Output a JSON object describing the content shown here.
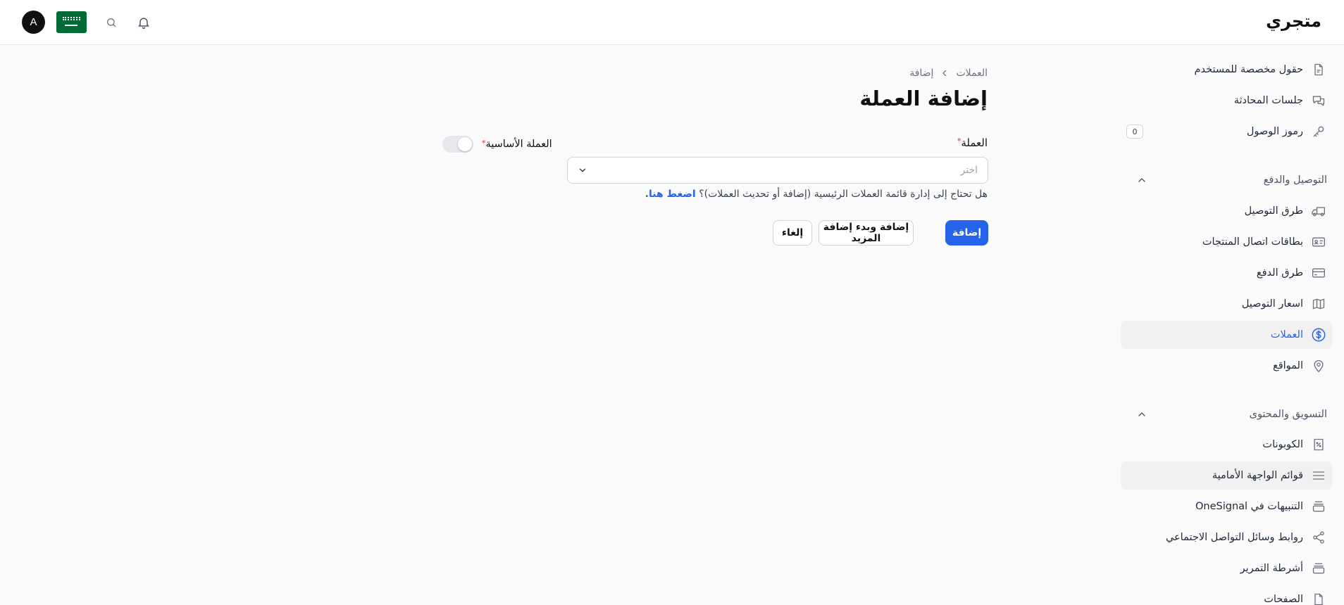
{
  "header": {
    "brand": "متجري",
    "avatar_letter": "A",
    "icons": {
      "notifications": "bell-icon",
      "search": "search-icon",
      "language": "saudi-flag-icon"
    }
  },
  "sidebar": {
    "items_top": [
      {
        "label": "حقول مخصصة للمستخدم",
        "icon": "document-icon"
      },
      {
        "label": "جلسات المحادثة",
        "icon": "chat-bubbles-icon"
      },
      {
        "label": "رموز الوصول",
        "icon": "key-icon",
        "badge": "0"
      }
    ],
    "section_shipping": {
      "title": "التوصيل والدفع",
      "items": [
        {
          "label": "طرق التوصيل",
          "icon": "truck-icon"
        },
        {
          "label": "بطاقات اتصال المنتجات",
          "icon": "id-card-icon"
        },
        {
          "label": "طرق الدفع",
          "icon": "credit-card-icon"
        },
        {
          "label": "اسعار التوصيل",
          "icon": "map-icon"
        },
        {
          "label": "العملات",
          "icon": "dollar-circle-icon",
          "active": true
        },
        {
          "label": "المواقع",
          "icon": "map-pin-icon"
        }
      ]
    },
    "section_marketing": {
      "title": "التسويق والمحتوى",
      "items": [
        {
          "label": "الكوبونات",
          "icon": "coupon-icon"
        },
        {
          "label": "قوائم الواجهة الأمامية",
          "icon": "menu-lines-icon"
        },
        {
          "label": "التنبيهات في OneSignal",
          "icon": "stack-icon"
        },
        {
          "label": "روابط وسائل التواصل الاجتماعي",
          "icon": "share-icon"
        },
        {
          "label": "أشرطة التمرير",
          "icon": "slides-icon"
        },
        {
          "label": "الصفحات",
          "icon": "page-icon"
        }
      ]
    }
  },
  "breadcrumb": {
    "parent": "العملات",
    "current": "إضافة"
  },
  "page": {
    "title": "إضافة العملة"
  },
  "form": {
    "currency_label": "العملة",
    "required_mark": "*",
    "select_placeholder": "اختر",
    "help_text": "هل تحتاج إلى إدارة قائمة العملات الرئيسية (إضافة أو تحديث العملات)؟",
    "help_link": "اضغط هنا.",
    "base_currency_label": "العملة الأساسية",
    "base_currency_on": false
  },
  "actions": {
    "add": "إضافة",
    "add_and_more": "إضافة وبدء إضافة المزيد",
    "cancel": "إلغاء"
  },
  "colors": {
    "accent": "#2563eb",
    "required": "#dc2626",
    "flag": "#006c35"
  }
}
